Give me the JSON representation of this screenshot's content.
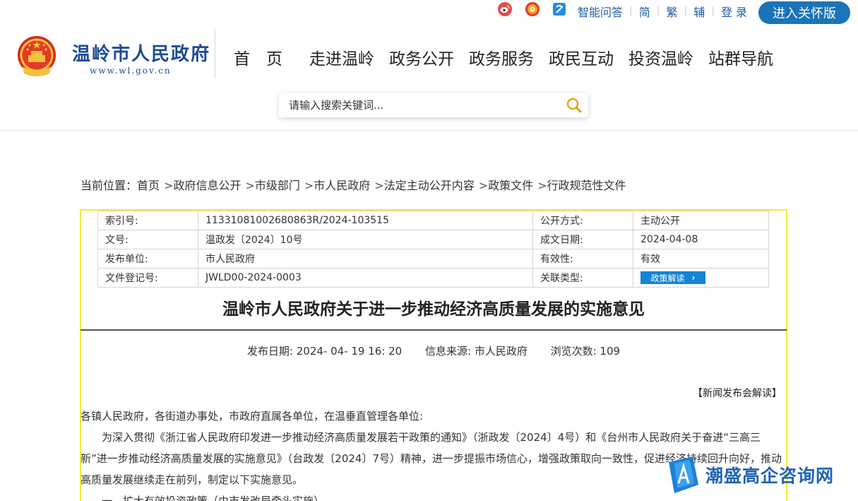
{
  "header": {
    "social_icons": [
      "weibo-icon",
      "toutiao-icon",
      "app-icon"
    ],
    "top_links": [
      "智能问答",
      "简",
      "繁",
      "辅",
      "登 录"
    ],
    "care_button": "进入关怀版",
    "logo_title": "温岭市人民政府",
    "logo_url": "www.wl.gov.cn",
    "nav": [
      "首　页",
      "走进温岭",
      "政务公开",
      "政务服务",
      "政民互动",
      "投资温岭",
      "站群导航"
    ],
    "search_placeholder": "请输入搜索关键词..."
  },
  "breadcrumb": {
    "prefix": "当前位置：",
    "items": [
      "首页",
      "政府信息公开",
      "市级部门",
      "市人民政府",
      "法定主动公开内容",
      "政策文件",
      "行政规范性文件"
    ]
  },
  "meta": {
    "rows": [
      {
        "k1": "索引号:",
        "v1": "11331081002680863R/2024-103515",
        "k2": "公开方式:",
        "v2": "主动公开"
      },
      {
        "k1": "文号:",
        "v1": "温政发〔2024〕10号",
        "k2": "成文日期:",
        "v2": "2024-04-08"
      },
      {
        "k1": "发布单位:",
        "v1": "市人民政府",
        "k2": "有效性:",
        "v2": "有效"
      },
      {
        "k1": "文件登记号:",
        "v1": "JWLD00-2024-0003",
        "k2": "关联类型:",
        "v2": ""
      }
    ],
    "policy_button": "政策解读"
  },
  "article": {
    "title": "温岭市人民政府关于进一步推动经济高质量发展的实施意见",
    "publish_date": "发布日期:  2024- 04- 19 16: 20",
    "source": "信息来源:  市人民政府",
    "views": "浏览次数:  109",
    "news_link": "【新闻发布会解读】",
    "paragraphs": [
      "各镇人民政府，各街道办事处，市政府直属各单位，在温垂直管理各单位:",
      "为深入贯彻《浙江省人民政府印发进一步推动经济高质量发展若干政策的通知》（浙政发〔2024〕4号）和《台州市人民政府关于奋进“三高三新”进一步推动经济高质量发展的实施意见》（台政发〔2024〕7号）精神，进一步提振市场信心，增强政策取向一致性，促进经济持续回升向好，推动高质量发展继续走在前列，制定以下实施意见。",
      "一、扩大有效投资政策（由市发改局牵头实施）"
    ]
  },
  "watermark": {
    "text": "潮盛高企咨询网",
    "logo_letter": "A"
  },
  "colors": {
    "brand_blue": "#1b73b8",
    "title_blue": "#1e4b95",
    "frame_yellow": "#f2ec35",
    "button_blue": "#1583d6"
  }
}
